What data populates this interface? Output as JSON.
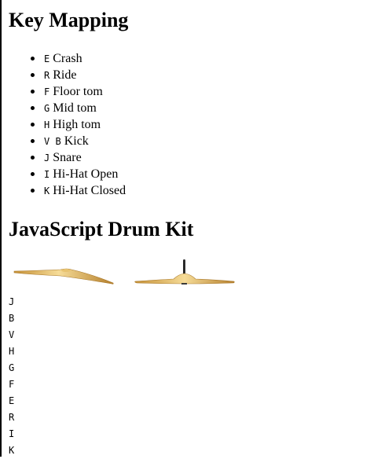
{
  "mapping": {
    "title": "Key Mapping",
    "items": [
      {
        "keys": "E",
        "label": "Crash"
      },
      {
        "keys": "R",
        "label": "Ride"
      },
      {
        "keys": "F",
        "label": "Floor tom"
      },
      {
        "keys": "G",
        "label": "Mid tom"
      },
      {
        "keys": "H",
        "label": "High tom"
      },
      {
        "keys": "V B",
        "label": "Kick"
      },
      {
        "keys": "J",
        "label": "Snare"
      },
      {
        "keys": "I",
        "label": "Hi-Hat Open"
      },
      {
        "keys": "K",
        "label": "Hi-Hat Closed"
      }
    ]
  },
  "kit": {
    "title": "JavaScript Drum Kit",
    "icons": [
      "crash-cymbal",
      "ride-cymbal"
    ],
    "cymbal_colors": {
      "light": "#f3d48a",
      "mid": "#d9a94a",
      "dark": "#a8782a"
    }
  },
  "key_elements": [
    "J",
    "B",
    "V",
    "H",
    "G",
    "F",
    "E",
    "R",
    "I",
    "K"
  ]
}
